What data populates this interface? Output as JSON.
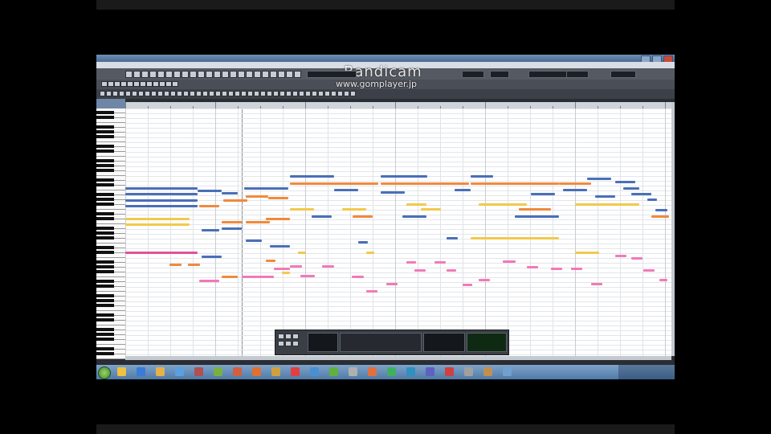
{
  "app": {
    "title": "",
    "menu": [
      "",
      "",
      "",
      "",
      "",
      "",
      "",
      "",
      "",
      "",
      "",
      ""
    ]
  },
  "watermark": {
    "brand": "Bandicam",
    "url": "www.gomplayer.jp"
  },
  "colors": {
    "grid_bg": "#ffffff",
    "note_blue": "#4a6fb8",
    "note_orange": "#f08a3c",
    "note_yellow": "#f2c94c",
    "note_magenta": "#e0529c",
    "note_pink": "#f07ab8",
    "keyboard_black": "#111111",
    "taskbar": "#5f88b5"
  },
  "icons": {
    "start": "windows-start-icon",
    "taskbar": [
      "explorer-icon",
      "ie-icon",
      "folder-icon",
      "media-icon",
      "app-icon",
      "app-icon",
      "app-icon",
      "firefox-icon",
      "app-icon",
      "chrome-icon",
      "app-icon",
      "app-icon",
      "app-icon",
      "app-icon",
      "app-icon",
      "app-icon",
      "app-icon",
      "app-icon",
      "app-icon",
      "app-icon",
      "app-icon"
    ]
  },
  "clock": {
    "time": "",
    "date": ""
  }
}
